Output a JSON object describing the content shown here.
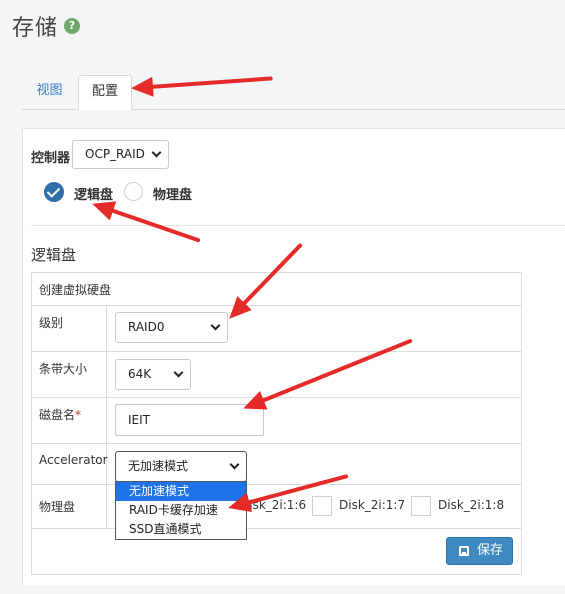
{
  "page": {
    "title": "存储",
    "help_icon": "?"
  },
  "tabs": [
    {
      "label": "视图"
    },
    {
      "label": "配置"
    }
  ],
  "controller": {
    "label": "控制器",
    "value": "OCP_RAID"
  },
  "radio": {
    "logical_label": "逻辑盘",
    "physical_label": "物理盘",
    "selected": "逻辑盘"
  },
  "section": {
    "title": "逻辑盘"
  },
  "form": {
    "header": "创建虚拟硬盘",
    "level": {
      "label": "级别",
      "value": "RAID0"
    },
    "stripe": {
      "label": "条带大小",
      "value": "64K"
    },
    "disk_name": {
      "label": "磁盘名",
      "required_mark": "*",
      "value": "IEIT"
    },
    "accelerator": {
      "label": "Accelerator",
      "value": "无加速模式",
      "options": [
        "无加速模式",
        "RAID卡缓存加速",
        "SSD直通模式"
      ]
    },
    "physical_disks": {
      "label": "物理盘",
      "disks": [
        "Disk_2i:1:6",
        "Disk_2i:1:7",
        "Disk_2i:1:8"
      ]
    }
  },
  "actions": {
    "save_label": "保存"
  },
  "colors": {
    "accent": "#3f8ac1",
    "link": "#3a7dc0",
    "annotation_arrow": "#e52a2a",
    "option_highlight": "#1e73e8"
  }
}
